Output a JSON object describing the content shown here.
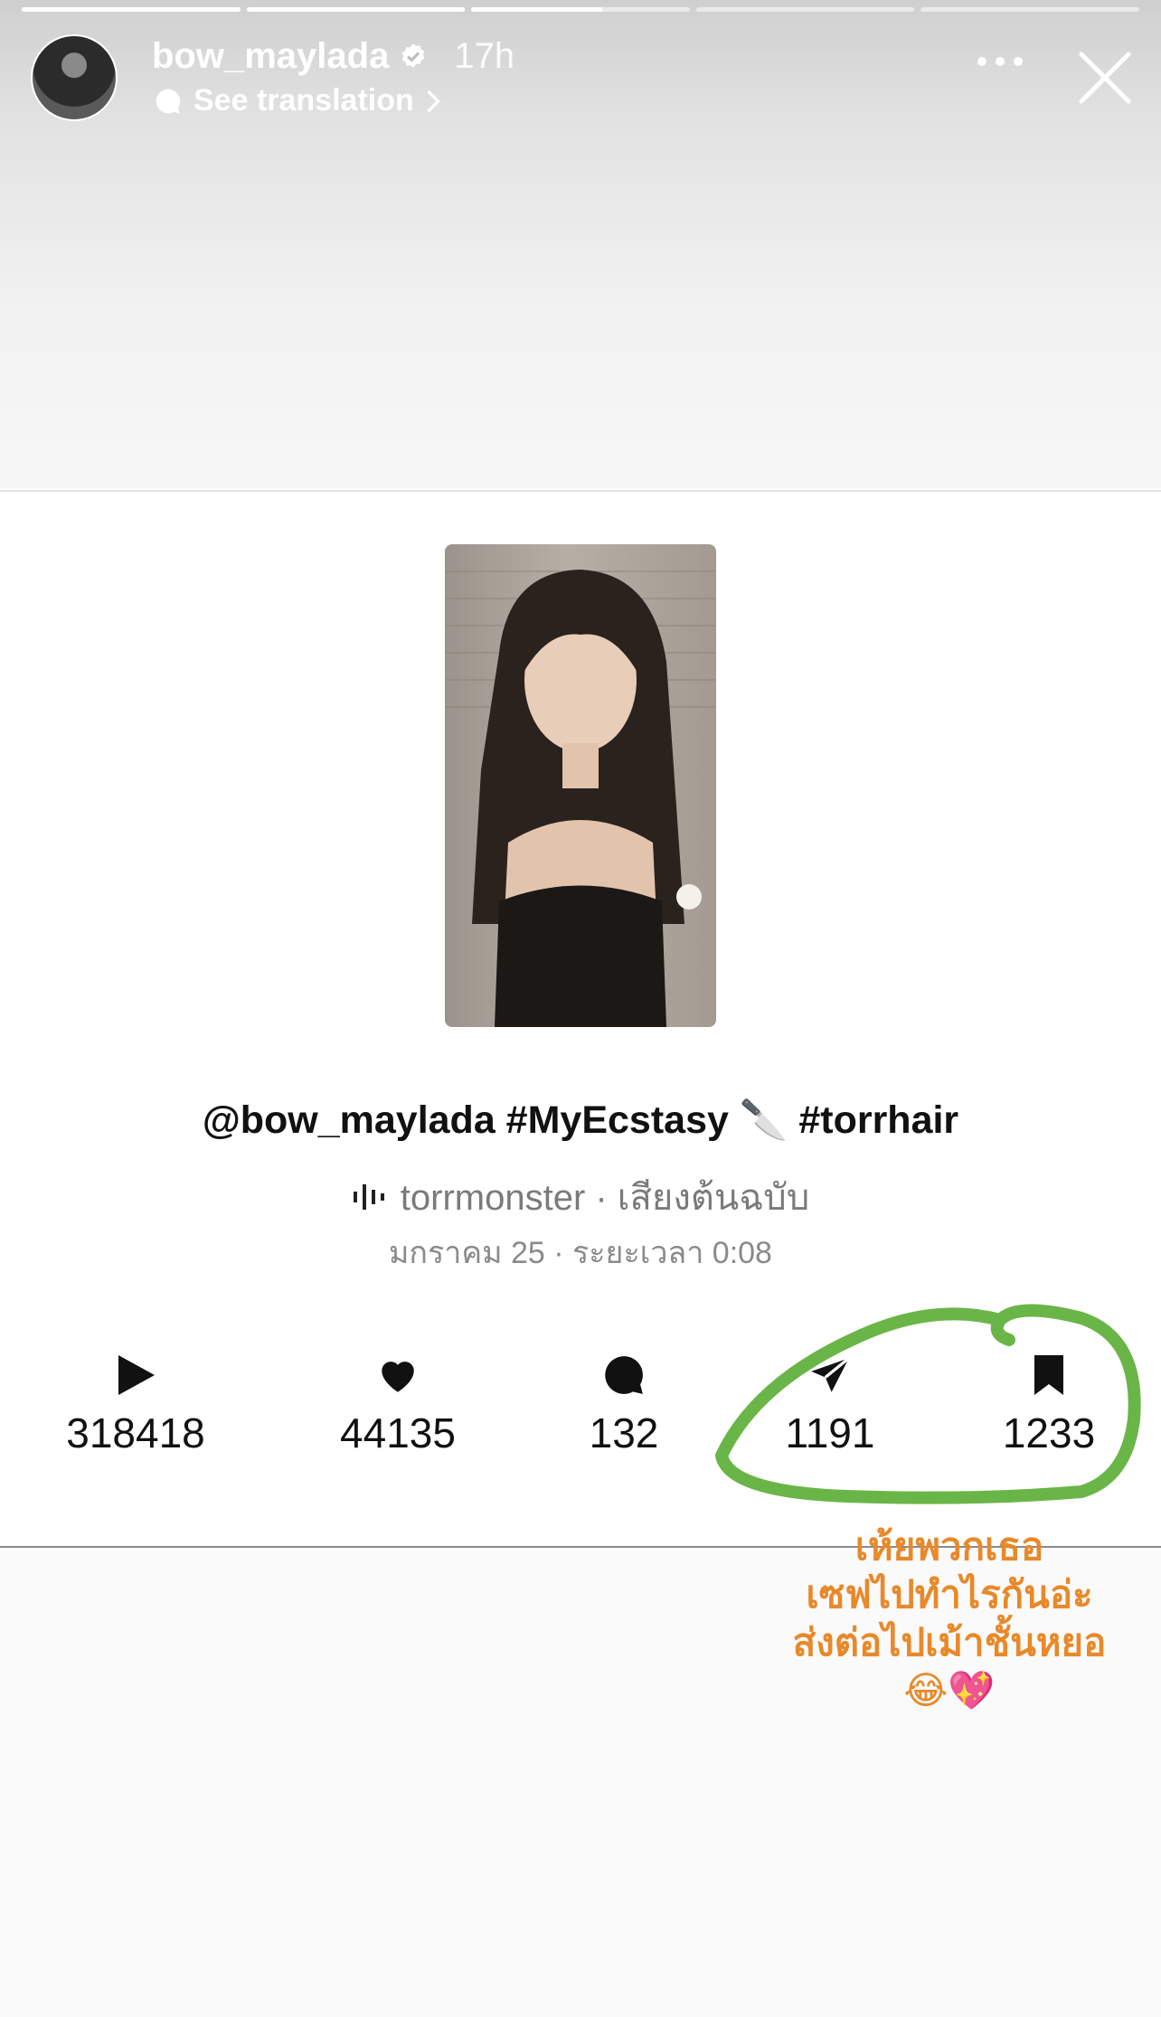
{
  "story": {
    "progress": [
      1.0,
      1.0,
      0.6,
      0.0,
      0.0
    ],
    "username": "bow_maylada",
    "time": "17h",
    "see_translation": "See translation"
  },
  "post": {
    "caption": "@bow_maylada #MyEcstasy 🔪 #torrhair",
    "audio": "torrmonster · เสียงต้นฉบับ",
    "date": "มกราคม 25 · ระยะเวลา 0:08"
  },
  "stats": {
    "plays": "318418",
    "likes": "44135",
    "comments": "132",
    "shares": "1191",
    "saves": "1233"
  },
  "annotation": {
    "line1": "เห้ยพวกเธอ",
    "line2": "เซฟไปทำไรกันอ่ะ",
    "line3": "ส่งต่อไปเม้าชั้นหยอ",
    "emoji": "😂💖"
  },
  "colors": {
    "annotation": "#e8892a",
    "circle": "#6ab547"
  }
}
